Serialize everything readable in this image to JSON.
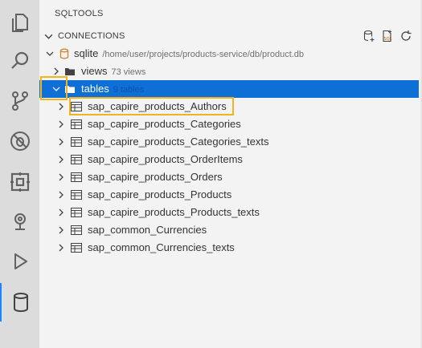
{
  "activity_bar": {
    "items": [
      {
        "icon": "explorer-icon"
      },
      {
        "icon": "search-icon"
      },
      {
        "icon": "source-control-icon"
      },
      {
        "icon": "debug-disabled-icon"
      },
      {
        "icon": "extensions-icon"
      },
      {
        "icon": "cloud-foundry-icon"
      },
      {
        "icon": "run-debug-icon"
      },
      {
        "icon": "database-icon",
        "active": true
      }
    ]
  },
  "sidebar": {
    "title": "SQLTOOLS",
    "section": {
      "label": "CONNECTIONS",
      "actions": [
        {
          "icon": "new-connection-icon"
        },
        {
          "icon": "new-sql-file-icon"
        },
        {
          "icon": "refresh-icon"
        }
      ]
    },
    "connection": {
      "label": "sqlite",
      "path": "/home/user/projects/products-service/db/product.db",
      "icon": "database-icon"
    },
    "views": {
      "label": "views",
      "count": "73 views"
    },
    "tables": {
      "label": "tables",
      "count": "9 tables"
    },
    "table_items": [
      "sap_capire_products_Authors",
      "sap_capire_products_Categories",
      "sap_capire_products_Categories_texts",
      "sap_capire_products_OrderItems",
      "sap_capire_products_Orders",
      "sap_capire_products_Products",
      "sap_capire_products_Products_texts",
      "sap_common_Currencies",
      "sap_common_Currencies_texts"
    ]
  },
  "colors": {
    "selection": "#0e70d6",
    "highlight_box": "#f0b51e",
    "active_indicator": "#1a85ff"
  }
}
